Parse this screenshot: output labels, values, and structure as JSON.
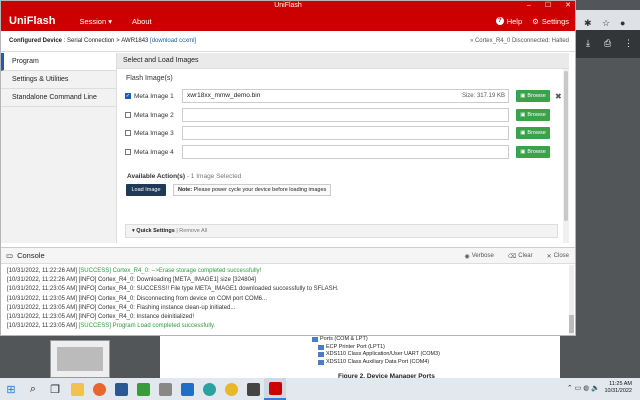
{
  "window": {
    "title": "UniFlash",
    "controls": [
      "–",
      "☐",
      "✕"
    ]
  },
  "menubar": {
    "brand": "UniFlash",
    "session": "Session ▾",
    "about": "About",
    "help": "Help",
    "settings": "Settings"
  },
  "config": {
    "label": "Configured Device",
    "connection": ": Serial Connection",
    "separator": ">",
    "device": "AWR1843",
    "download_link": "[download ccxml]",
    "status": "» Cortex_R4_0 Disconnected: Halted"
  },
  "sidebar": {
    "items": [
      {
        "label": "Program",
        "active": true
      },
      {
        "label": "Settings & Utilities",
        "active": false
      },
      {
        "label": "Standalone Command Line",
        "active": false
      }
    ]
  },
  "main": {
    "header": "Select and Load Images",
    "flash_label": "Flash Image(s)",
    "images": [
      {
        "label": "Meta Image 1",
        "checked": true,
        "file": "xwr18xx_mmw_demo.bin",
        "size": "Size: 317.19 KB",
        "browse": "Browse"
      },
      {
        "label": "Meta Image 2",
        "checked": false,
        "file": "",
        "size": "",
        "browse": "Browse"
      },
      {
        "label": "Meta Image 3",
        "checked": false,
        "file": "",
        "size": "",
        "browse": "Browse"
      },
      {
        "label": "Meta Image 4",
        "checked": false,
        "file": "",
        "size": "",
        "browse": "Browse"
      }
    ],
    "actions_label": "Available Action(s)",
    "actions_count": " - 1 Image Selected",
    "load_button": "Load Image",
    "note_bold": "Note:",
    "note_text": " Please power cycle your device before loading images",
    "quick_settings": "Quick Settings",
    "remove_all": " | Remove All"
  },
  "console": {
    "title": "Console",
    "verbose": "Verbose",
    "clear": "Clear",
    "close": "Close",
    "lines": [
      {
        "prefix": "[10/31/2022, 11:22:26 AM] ",
        "tag": "[SUCCESS] Cortex_R4_0: -->Erase storage completed successfully!",
        "ok": true
      },
      {
        "prefix": "[10/31/2022, 11:22:26 AM] ",
        "tag": "[INFO] Cortex_R4_0: Downloading [META_IMAGE1] size [324804]",
        "ok": false
      },
      {
        "prefix": "[10/31/2022, 11:23:05 AM] ",
        "tag": "[INFO] Cortex_R4_0: SUCCESS!! File type META_IMAGE1 downloaded successfully to SFLASH.",
        "ok": false
      },
      {
        "prefix": "[10/31/2022, 11:23:05 AM] ",
        "tag": "[INFO] Cortex_R4_0: Disconnecting from device on COM port COM6...",
        "ok": false
      },
      {
        "prefix": "[10/31/2022, 11:23:05 AM] ",
        "tag": "[INFO] Cortex_R4_0: Flashing instance clean-up initiated...",
        "ok": false
      },
      {
        "prefix": "[10/31/2022, 11:23:05 AM] ",
        "tag": "[INFO] Cortex_R4_0: Instance deinitialized!",
        "ok": false
      },
      {
        "prefix": "[10/31/2022, 11:23:05 AM] ",
        "tag": "[SUCCESS] Program Load completed successfully.",
        "ok": true
      }
    ]
  },
  "background": {
    "device_tree": [
      "Ports (COM & LPT)",
      "ECP Printer Port (LPT1)",
      "XDS110 Class Application/User UART (COM3)",
      "XDS110 Class Auxiliary Data Port (COM4)"
    ],
    "figure_caption": "Figure 2. Device Manager Ports"
  },
  "taskbar": {
    "time": "11:25 AM",
    "date": "10/31/2022"
  }
}
